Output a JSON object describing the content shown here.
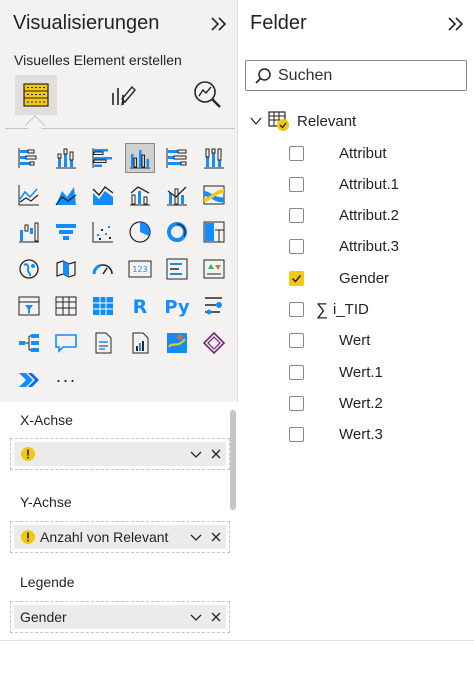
{
  "visualizations": {
    "title": "Visualisierungen",
    "subtitle": "Visuelles Element erstellen",
    "mode_icons": [
      "build-visual-icon",
      "format-visual-icon",
      "analytics-icon"
    ],
    "tiles": [
      "stacked-bar-chart-icon",
      "stacked-column-chart-icon",
      "clustered-bar-chart-icon",
      "clustered-column-chart-icon",
      "100-stacked-bar-chart-icon",
      "100-stacked-column-chart-icon",
      "line-chart-icon",
      "area-chart-icon",
      "stacked-area-chart-icon",
      "line-clustered-column-icon",
      "line-stacked-column-icon",
      "ribbon-chart-icon",
      "waterfall-chart-icon",
      "funnel-chart-icon",
      "scatter-chart-icon",
      "pie-chart-icon",
      "donut-chart-icon",
      "treemap-icon",
      "map-icon",
      "filled-map-icon",
      "gauge-icon",
      "card-icon",
      "multi-row-card-icon",
      "kpi-icon",
      "slicer-icon",
      "table-icon",
      "matrix-icon",
      "r-visual-icon",
      "python-visual-icon",
      "key-influencers-icon",
      "decomposition-tree-icon",
      "qa-icon",
      "smart-narrative-icon",
      "paginated-report-icon",
      "azure-map-icon",
      "power-apps-icon",
      "power-automate-icon",
      "more-visuals-icon"
    ],
    "more_label": "···",
    "wells": {
      "x_axis": {
        "label": "X-Achse",
        "value": ""
      },
      "y_axis": {
        "label": "Y-Achse",
        "value": "Anzahl von Relevant"
      },
      "legend": {
        "label": "Legende",
        "value": "Gender"
      }
    }
  },
  "fields": {
    "title": "Felder",
    "search_placeholder": "Suchen",
    "table_name": "Relevant",
    "items": [
      {
        "name": "Attribut",
        "checked": false,
        "sigma": false
      },
      {
        "name": "Attribut.1",
        "checked": false,
        "sigma": false
      },
      {
        "name": "Attribut.2",
        "checked": false,
        "sigma": false
      },
      {
        "name": "Attribut.3",
        "checked": false,
        "sigma": false
      },
      {
        "name": "Gender",
        "checked": true,
        "sigma": false
      },
      {
        "name": "i_TID",
        "checked": false,
        "sigma": true
      },
      {
        "name": "Wert",
        "checked": false,
        "sigma": false
      },
      {
        "name": "Wert.1",
        "checked": false,
        "sigma": false
      },
      {
        "name": "Wert.2",
        "checked": false,
        "sigma": false
      },
      {
        "name": "Wert.3",
        "checked": false,
        "sigma": false
      }
    ]
  },
  "colors": {
    "accent": "#f2c811",
    "blue": "#118dff",
    "dark": "#252423",
    "pane_bg": "#f3f2f1"
  }
}
